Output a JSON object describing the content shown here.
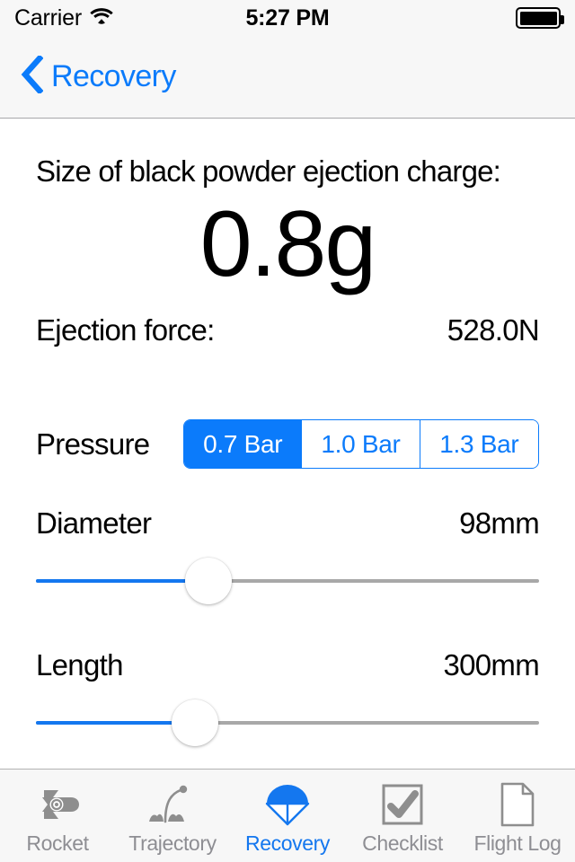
{
  "status_bar": {
    "carrier": "Carrier",
    "wifi_icon": "wifi-icon",
    "time": "5:27 PM",
    "battery_icon": "battery-full-icon"
  },
  "nav_bar": {
    "back_icon": "chevron-left-icon",
    "back_label": "Recovery"
  },
  "main": {
    "charge_title": "Size of black powder ejection charge:",
    "charge_value": "0.8g",
    "ejection_force_label": "Ejection force:",
    "ejection_force_value": "528.0N",
    "pressure_label": "Pressure",
    "pressure_options": [
      {
        "label": "0.7 Bar",
        "selected": true
      },
      {
        "label": "1.0 Bar",
        "selected": false
      },
      {
        "label": "1.3 Bar",
        "selected": false
      }
    ],
    "diameter_label": "Diameter",
    "diameter_value": "98mm",
    "diameter_percent": 34,
    "length_label": "Length",
    "length_value": "300mm",
    "length_percent": 32
  },
  "tab_bar": {
    "items": [
      {
        "label": "Rocket",
        "icon": "rocket-icon",
        "active": false
      },
      {
        "label": "Trajectory",
        "icon": "trajectory-icon",
        "active": false
      },
      {
        "label": "Recovery",
        "icon": "parachute-icon",
        "active": true
      },
      {
        "label": "Checklist",
        "icon": "checkbox-check-icon",
        "active": false
      },
      {
        "label": "Flight Log",
        "icon": "document-icon",
        "active": false
      }
    ]
  },
  "colors": {
    "accent_blue": "#0b7bfb",
    "tab_blue": "#1477ef",
    "inactive_gray": "#8e8e93",
    "icon_gray": "#8e8e8e",
    "bar_background": "#f7f7f7"
  }
}
